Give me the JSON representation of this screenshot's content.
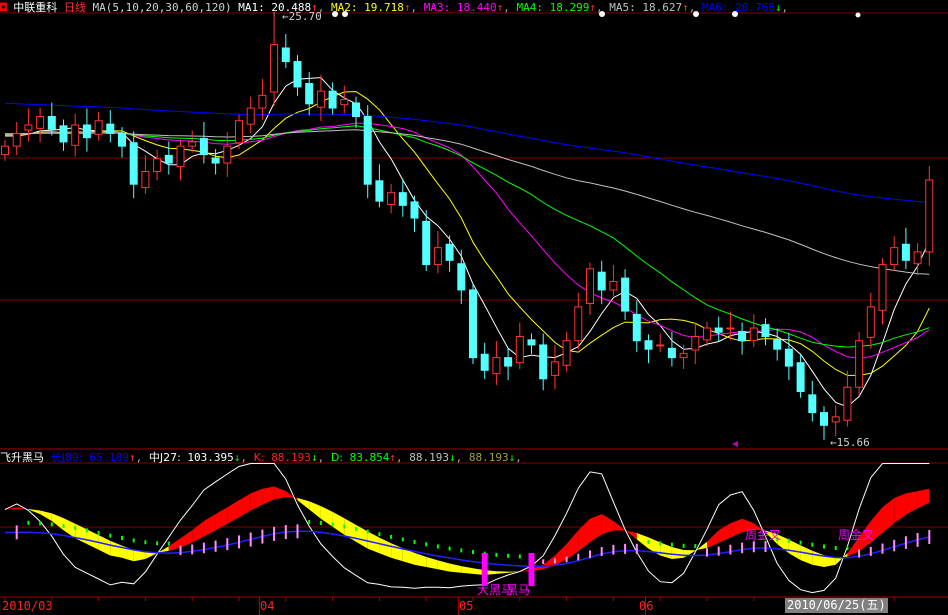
{
  "header": {
    "stock_name": "中联重科",
    "period": "日线",
    "ma_params": "MA(5,10,20,30,60,120)",
    "ma_values": [
      {
        "label": "MA1:",
        "value": "20.488",
        "arrow": "↑",
        "color": "#ffffff"
      },
      {
        "label": "MA2:",
        "value": "19.718",
        "arrow": "↑",
        "color": "#ffff00"
      },
      {
        "label": "MA3:",
        "value": "18.440",
        "arrow": "↑",
        "color": "#ff00ff"
      },
      {
        "label": "MA4:",
        "value": "18.299",
        "arrow": "↑",
        "color": "#00ff00"
      },
      {
        "label": "MA5:",
        "value": "18.627",
        "arrow": "↑",
        "color": "#c0c0c0"
      },
      {
        "label": "MA6:",
        "value": "20.768",
        "arrow": "↓",
        "color": "#0000ff"
      }
    ]
  },
  "indicator_header": {
    "name": "飞升黑马",
    "items": [
      {
        "label": "长J89:",
        "value": "65.109",
        "arrow": "↑",
        "color": "#0000ff"
      },
      {
        "label": "中J27:",
        "value": "103.395",
        "arrow": "↓",
        "color": "#ffffff"
      },
      {
        "label": "K:",
        "value": "88.193",
        "arrow": "↓",
        "color": "#ff2020"
      },
      {
        "label": "D:",
        "value": "83.854",
        "arrow": "↑",
        "color": "#00ff00"
      },
      {
        "label": "",
        "value": "88.193",
        "arrow": "↓",
        "color": "#c0c0c0"
      },
      {
        "label": "",
        "value": "88.193",
        "arrow": "↓",
        "color": "#a0a040"
      }
    ]
  },
  "annotations": {
    "high_label": "25.70",
    "low_label": "15.66",
    "signal_big": "大黑马",
    "signal_small": "黑马",
    "weekly_cross_1": "周金叉",
    "weekly_cross_2": "周金叉"
  },
  "date_axis": {
    "labels": [
      "2010/03",
      "04",
      "05",
      "06"
    ],
    "cursor_date": "2010/06/25(五)"
  },
  "colors": {
    "up": "#ff3232",
    "down": "#54ffff",
    "grid": "#800000",
    "band_up": "#ff0000",
    "band_down": "#ffff00"
  },
  "chart_data": {
    "type": "candlestick",
    "title": "中联重科 日线",
    "ylim": [
      15.3,
      26.0
    ],
    "high": 25.7,
    "low": 15.66,
    "month_start_index": {
      "04": 22,
      "05": 39,
      "06": 55
    },
    "closes": [
      22.6,
      22.9,
      23.1,
      23.3,
      23.0,
      22.7,
      23.1,
      22.8,
      23.2,
      22.9,
      22.6,
      21.7,
      22.0,
      22.3,
      22.2,
      22.6,
      22.7,
      22.4,
      22.2,
      22.6,
      23.2,
      23.5,
      23.8,
      25.0,
      24.6,
      24.0,
      23.6,
      23.9,
      23.5,
      23.7,
      23.3,
      21.7,
      21.3,
      21.5,
      21.2,
      20.9,
      19.8,
      20.2,
      19.9,
      19.2,
      17.6,
      17.3,
      17.6,
      17.4,
      18.1,
      17.9,
      17.1,
      17.5,
      18.0,
      18.8,
      19.7,
      19.2,
      19.4,
      18.7,
      18.0,
      17.8,
      17.9,
      17.6,
      17.7,
      18.1,
      18.3,
      18.2,
      18.3,
      18.0,
      18.3,
      18.1,
      17.8,
      17.4,
      16.8,
      16.3,
      16.0,
      16.2,
      16.9,
      18.0,
      18.8,
      19.8,
      20.2,
      19.9,
      20.1,
      21.8
    ],
    "indicator": {
      "name": "飞升黑马",
      "ylim": [
        0,
        110
      ],
      "k": [
        70,
        72,
        70,
        66,
        60,
        52,
        45,
        40,
        35,
        30,
        28,
        25,
        27,
        32,
        38,
        45,
        52,
        60,
        66,
        72,
        78,
        84,
        88,
        90,
        86,
        78,
        70,
        62,
        55,
        48,
        42,
        36,
        32,
        28,
        25,
        22,
        20,
        18,
        16,
        15,
        14,
        13,
        14,
        15,
        16,
        18,
        22,
        30,
        40,
        52,
        62,
        66,
        60,
        52,
        44,
        36,
        30,
        27,
        28,
        34,
        42,
        52,
        58,
        62,
        58,
        50,
        40,
        32,
        26,
        22,
        20,
        22,
        32,
        46,
        60,
        72,
        80,
        84,
        86,
        88
      ],
      "black_horse_index": [
        41,
        45
      ]
    }
  }
}
